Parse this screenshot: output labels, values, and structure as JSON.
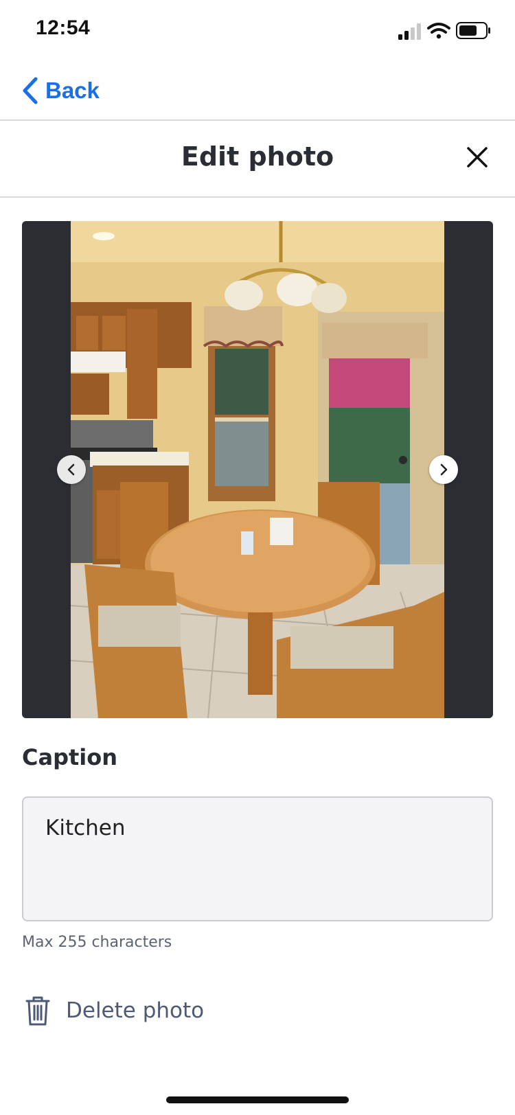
{
  "status_bar": {
    "time": "12:54",
    "icons": [
      "cellular-signal-icon",
      "wifi-icon",
      "battery-icon"
    ]
  },
  "nav": {
    "back_label": "Back",
    "back_icon": "chevron-left-icon"
  },
  "header": {
    "title": "Edit photo",
    "close_icon": "close-icon"
  },
  "photo_viewer": {
    "prev_icon": "chevron-left-icon",
    "next_icon": "chevron-right-icon",
    "photo_subject": "kitchen-photo"
  },
  "caption": {
    "label": "Caption",
    "value": "Kitchen",
    "hint": "Max 255 characters"
  },
  "delete": {
    "label": "Delete photo",
    "icon": "trash-icon"
  },
  "colors": {
    "accent": "#1a6fe8",
    "viewer_bg": "#2b2d33",
    "muted_text": "#4e5a75"
  }
}
